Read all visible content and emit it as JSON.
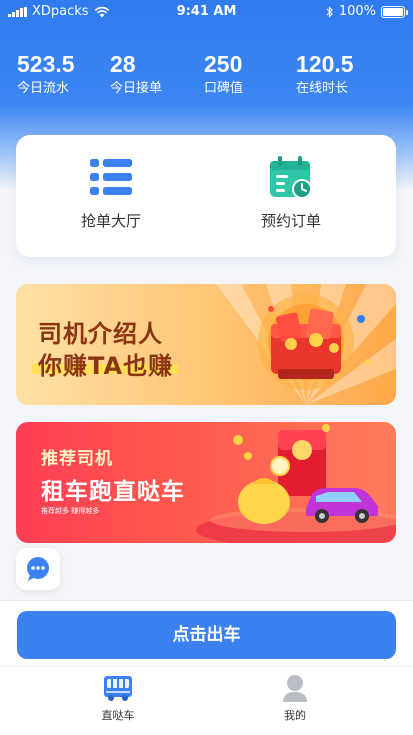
{
  "status_bar": {
    "carrier": "XDpacks",
    "time": "9:41 AM",
    "battery": "100%",
    "icons": [
      "signal-icon",
      "wifi-icon",
      "bluetooth-icon",
      "battery-icon"
    ]
  },
  "stats": [
    {
      "value": "523.5",
      "label": "今日流水"
    },
    {
      "value": "28",
      "label": "今日接单"
    },
    {
      "value": "250",
      "label": "口碑值"
    },
    {
      "value": "120.5",
      "label": "在线时长"
    }
  ],
  "menu": [
    {
      "label": "抢单大厅",
      "icon": "list-icon"
    },
    {
      "label": "预约订单",
      "icon": "calendar-clock-icon"
    }
  ],
  "banners": [
    {
      "line1": "司机介绍人",
      "line2": "你赚TA也赚"
    },
    {
      "line1": "推荐司机",
      "line2": "租车跑直哒车",
      "line3": "推荐越多 赚得越多"
    }
  ],
  "chat": {
    "icon": "chat-bubble-icon"
  },
  "depart_button": {
    "label": "点击出车"
  },
  "tabs": [
    {
      "label": "直哒车",
      "icon": "bus-icon",
      "active": true
    },
    {
      "label": "我的",
      "icon": "user-icon",
      "active": false
    }
  ],
  "colors": {
    "primary": "#3b82f0",
    "header": "#2f7bef",
    "banner1_text": "#8b3512",
    "banner2_bg": "#ff3d55",
    "accent_teal": "#2ec7a8"
  }
}
